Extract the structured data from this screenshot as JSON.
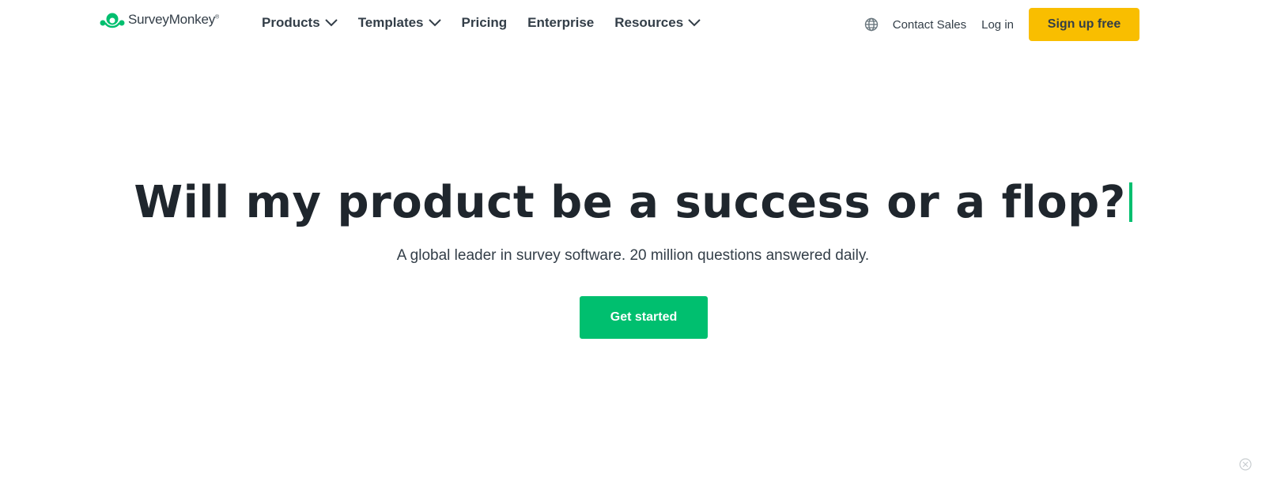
{
  "brand": {
    "name": "SurveyMonkey",
    "trademark": "®",
    "logo_icon": "monkey-logo-icon",
    "logo_color": "#00bf6f"
  },
  "nav": {
    "items": [
      {
        "label": "Products",
        "dropdown": true
      },
      {
        "label": "Templates",
        "dropdown": true
      },
      {
        "label": "Pricing",
        "dropdown": false
      },
      {
        "label": "Enterprise",
        "dropdown": false
      },
      {
        "label": "Resources",
        "dropdown": true
      }
    ]
  },
  "right_nav": {
    "globe_icon": "globe-icon",
    "contact": "Contact Sales",
    "login": "Log in",
    "signup": "Sign up free"
  },
  "hero": {
    "title": "Will my product be a success or a flop?",
    "subtitle": "A global leader in survey software. 20 million questions answered daily.",
    "cta": "Get started"
  },
  "colors": {
    "accent_green": "#00bf6f",
    "signup_yellow": "#f9be00",
    "text_dark": "#1f262d"
  }
}
